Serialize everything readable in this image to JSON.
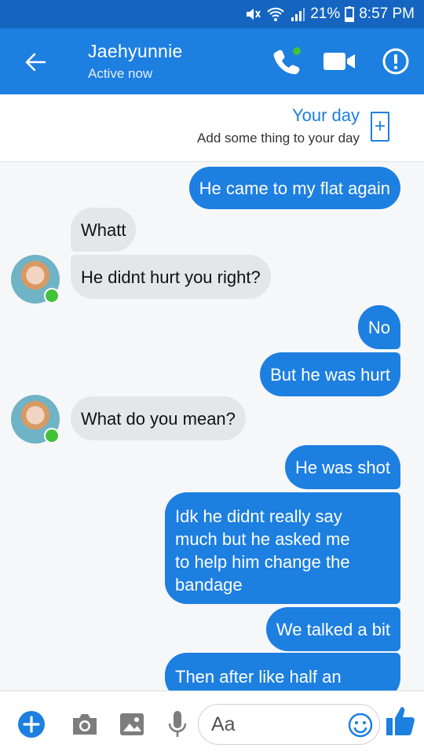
{
  "status_bar": {
    "battery": "21%",
    "time": "8:57 PM"
  },
  "header": {
    "contact_name": "Jaehyunnie",
    "status": "Active now",
    "accent_color": "#1d7fe0"
  },
  "your_day": {
    "title": "Your day",
    "subtitle": "Add some thing to your day"
  },
  "messages": [
    {
      "from": "me",
      "text": "He came to my flat again"
    },
    {
      "from": "them",
      "text": "Whatt"
    },
    {
      "from": "them",
      "text": "He didnt hurt you right?"
    },
    {
      "from": "me",
      "text": "No"
    },
    {
      "from": "me",
      "text": "But he was hurt"
    },
    {
      "from": "them",
      "text": "What do you mean?"
    },
    {
      "from": "me",
      "text": "He was shot"
    },
    {
      "from": "me",
      "lines": [
        "Idk he didnt really say",
        "much but he asked me",
        "to help him change the",
        "bandage"
      ]
    },
    {
      "from": "me",
      "text": "We talked a bit"
    },
    {
      "from": "me",
      "text": "Then after like half an"
    }
  ],
  "composer": {
    "placeholder": "Aa"
  }
}
